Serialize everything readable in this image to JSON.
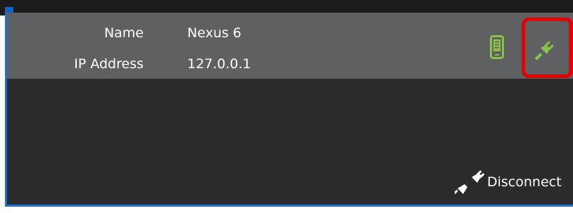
{
  "device": {
    "name_label": "Name",
    "name_value": "Nexus 6",
    "ip_label": "IP Address",
    "ip_value": "127.0.0.1"
  },
  "icons": {
    "device": "phone-icon",
    "connection": "plug-icon",
    "disconnect": "unplug-icon"
  },
  "actions": {
    "disconnect_label": "Disconnect"
  },
  "colors": {
    "panel_bg": "#2b2b2b",
    "row_bg": "#5f6062",
    "accent_blue": "#1e6fd0",
    "icon_green": "#8bc34a",
    "highlight_red": "#e60000"
  }
}
